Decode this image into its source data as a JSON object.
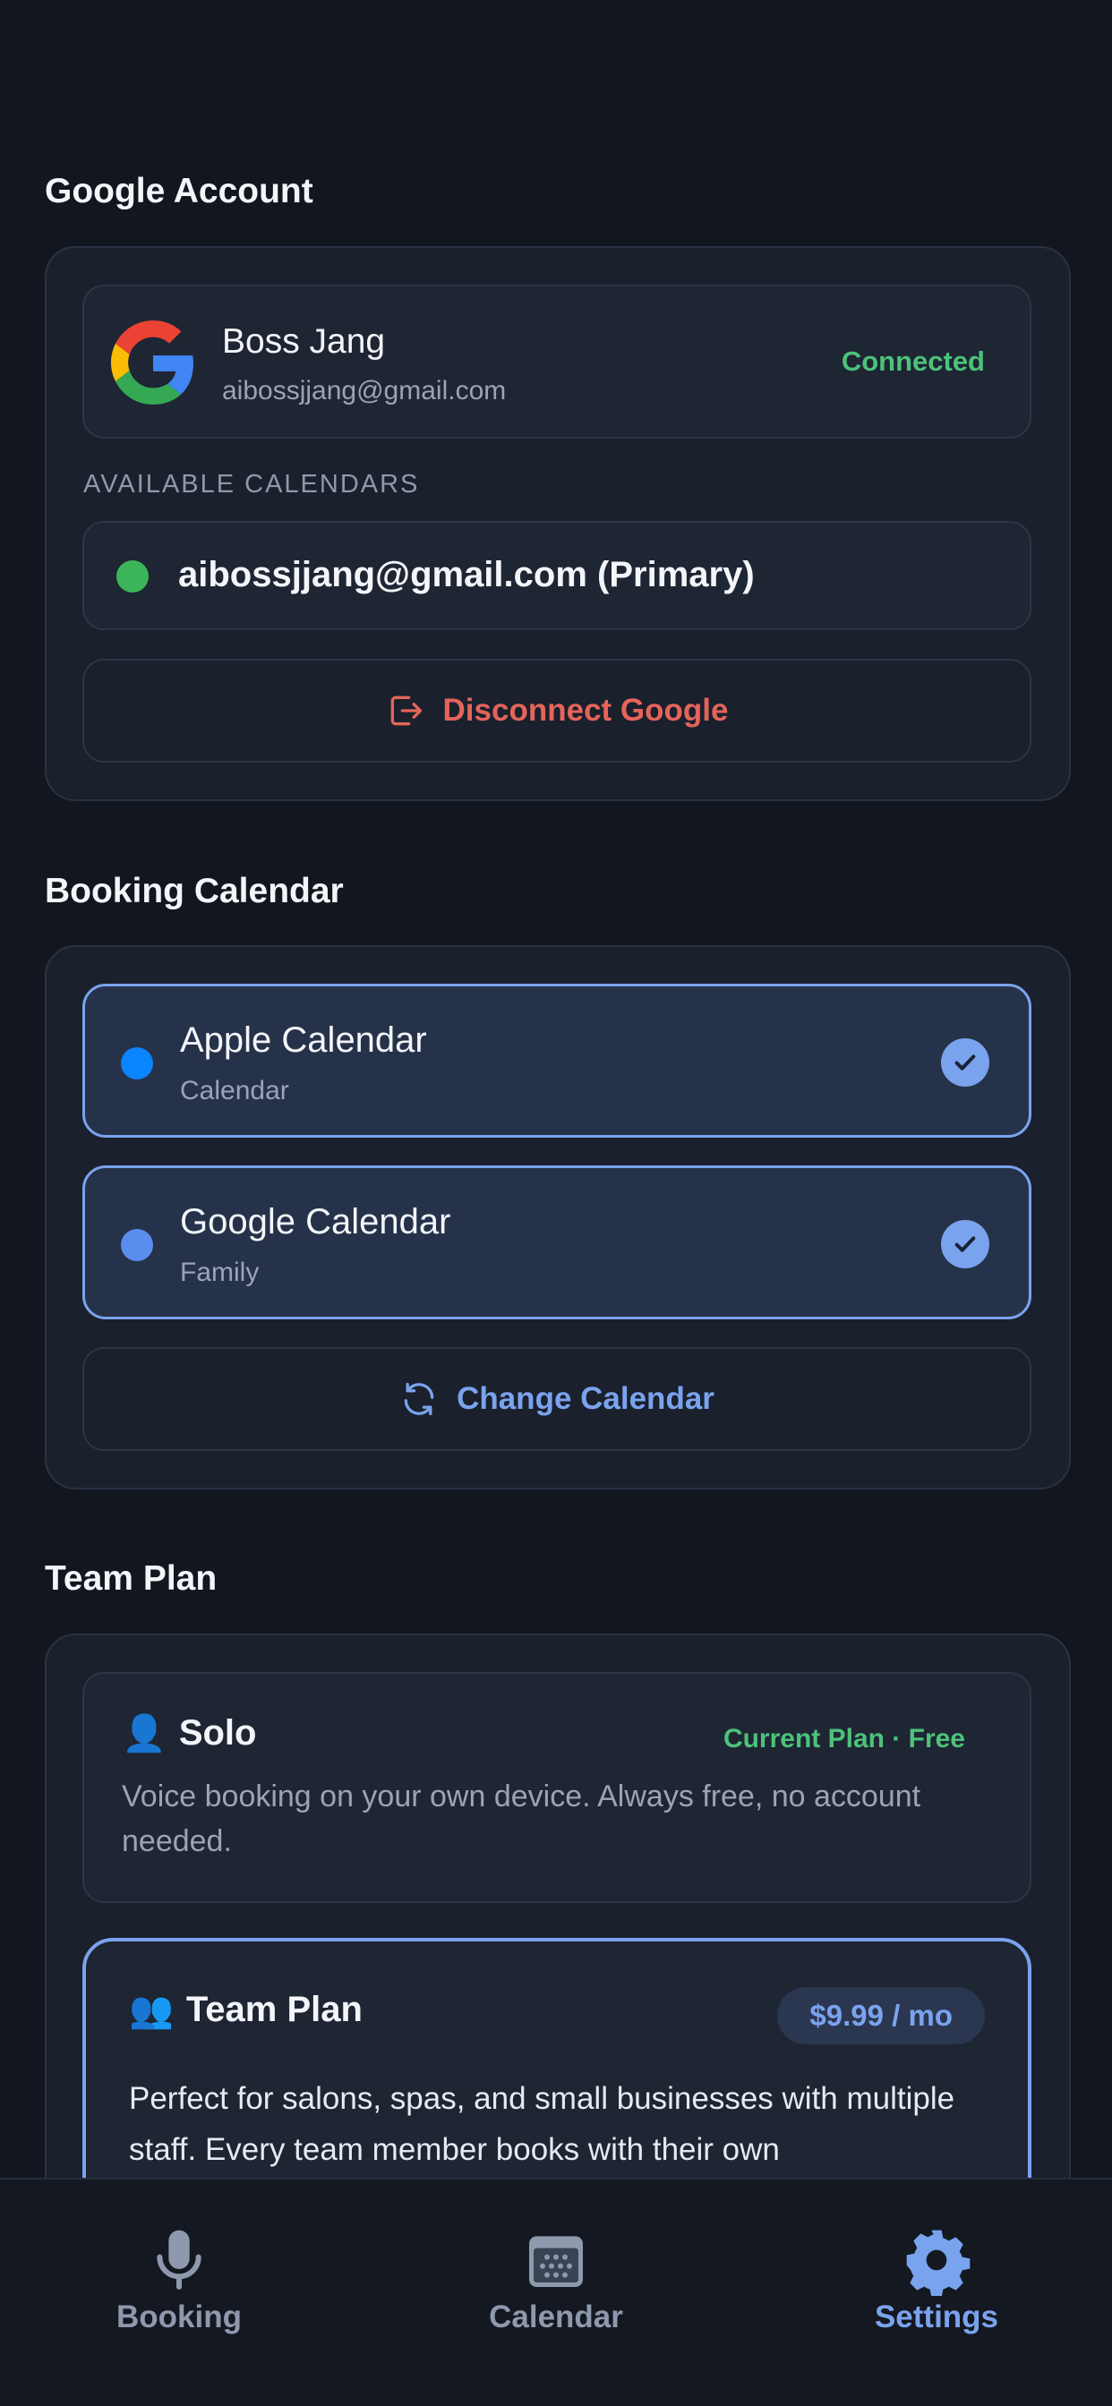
{
  "google_account": {
    "section_title": "Google Account",
    "name": "Boss Jang",
    "email": "aibossjjang@gmail.com",
    "status": "Connected",
    "available_label": "AVAILABLE CALENDARS",
    "calendar_name": "aibossjjang@gmail.com (Primary)",
    "disconnect_label": "Disconnect Google"
  },
  "booking_calendar": {
    "section_title": "Booking Calendar",
    "calendars": [
      {
        "name": "Apple Calendar",
        "sub": "Calendar",
        "color": "#0a84ff",
        "selected": true
      },
      {
        "name": "Google Calendar",
        "sub": "Family",
        "color": "#5b8def",
        "selected": true
      }
    ],
    "change_label": "Change Calendar"
  },
  "team_plan": {
    "section_title": "Team Plan",
    "solo": {
      "emoji": "👤",
      "title": "Solo",
      "tag": "Current Plan · Free",
      "description": "Voice booking on your own device. Always free, no account needed."
    },
    "team": {
      "emoji": "👥",
      "title": "Team Plan",
      "price": "$9.99 / mo",
      "description": "Perfect for salons, spas, and small businesses with multiple staff. Every team member books with their own"
    }
  },
  "tabs": [
    {
      "label": "Booking",
      "icon": "microphone-icon",
      "active": false
    },
    {
      "label": "Calendar",
      "icon": "calendar-icon",
      "active": false
    },
    {
      "label": "Settings",
      "icon": "gear-icon",
      "active": true
    }
  ],
  "colors": {
    "accent": "#7aa3ee",
    "success": "#4cc27a",
    "danger": "#e5645a",
    "background": "#12161e"
  }
}
